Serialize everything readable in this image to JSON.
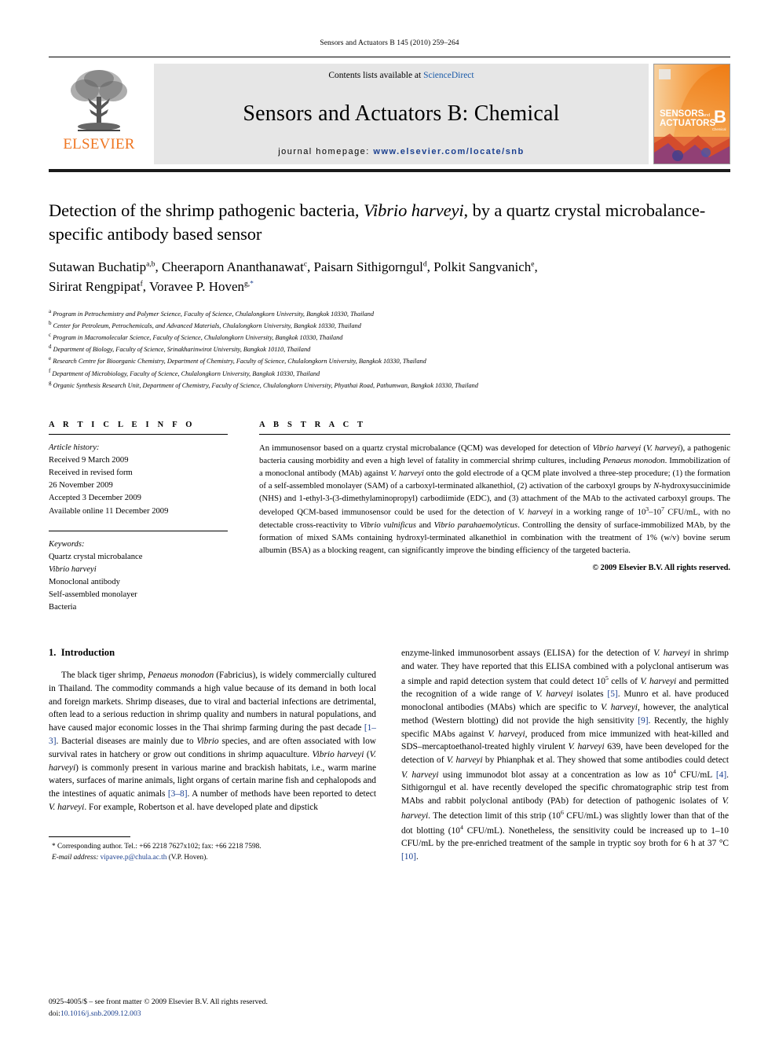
{
  "running_head": "Sensors and Actuators B 145 (2010) 259–264",
  "masthead": {
    "publisher": "ELSEVIER",
    "contents_prefix": "Contents lists available at ",
    "contents_link": "ScienceDirect",
    "journal_title": "Sensors and Actuators B: Chemical",
    "homepage_label": "journal homepage:",
    "homepage_url": "www.elsevier.com/locate/snb",
    "cover": {
      "line1": "SENSORS",
      "line1_suffix": "and",
      "line2": "ACTUATORS",
      "letter": "B",
      "sublabel": "Chemical",
      "accent_color": "#f07d19",
      "background_color": "#f3a24a"
    }
  },
  "article": {
    "title_part1": "Detection of the shrimp pathogenic bacteria, ",
    "title_italic": "Vibrio harveyi",
    "title_part2": ", by a quartz crystal microbalance-specific antibody based sensor",
    "authors": [
      {
        "name": "Sutawan Buchatip",
        "sup": "a,b",
        "sep": ", "
      },
      {
        "name": "Cheeraporn Ananthanawat",
        "sup": "c",
        "sep": ", "
      },
      {
        "name": "Paisarn Sithigorngul",
        "sup": "d",
        "sep": ", "
      },
      {
        "name": "Polkit Sangvanich",
        "sup": "e",
        "sep": ", "
      },
      {
        "name": "Sirirat Rengpipat",
        "sup": "f",
        "sep": ", "
      },
      {
        "name": "Voravee P. Hoven",
        "sup": "g,",
        "sep": ""
      }
    ],
    "corresponding_marker": "*",
    "affiliations": [
      {
        "mark": "a",
        "text": "Program in Petrochemistry and Polymer Science, Faculty of Science, Chulalongkorn University, Bangkok 10330, Thailand"
      },
      {
        "mark": "b",
        "text": "Center for Petroleum, Petrochemicals, and Advanced Materials, Chulalongkorn University, Bangkok 10330, Thailand"
      },
      {
        "mark": "c",
        "text": "Program in Macromolecular Science, Faculty of Science, Chulalongkorn University, Bangkok 10330, Thailand"
      },
      {
        "mark": "d",
        "text": "Department of Biology, Faculty of Science, Srinakharinwirot University, Bangkok 10110, Thailand"
      },
      {
        "mark": "e",
        "text": "Research Centre for Bioorganic Chemistry, Department of Chemistry, Faculty of Science, Chulalongkorn University, Bangkok 10330, Thailand"
      },
      {
        "mark": "f",
        "text": "Department of Microbiology, Faculty of Science, Chulalongkorn University, Bangkok 10330, Thailand"
      },
      {
        "mark": "g",
        "text": "Organic Synthesis Research Unit, Department of Chemistry, Faculty of Science, Chulalongkorn University, Phyathai Road, Pathumwan, Bangkok 10330, Thailand"
      }
    ]
  },
  "article_info": {
    "heading": "A R T I C L E    I N F O",
    "history_label": "Article history:",
    "history": [
      "Received 9 March 2009",
      "Received in revised form",
      "26 November 2009",
      "Accepted 3 December 2009",
      "Available online 11 December 2009"
    ],
    "keywords_label": "Keywords:",
    "keywords": [
      "Quartz crystal microbalance",
      "Vibrio harveyi",
      "Monoclonal antibody",
      "Self-assembled monolayer",
      "Bacteria"
    ],
    "keywords_italic_index": 1
  },
  "abstract": {
    "heading": "A B S T R A C T",
    "copyright": "© 2009 Elsevier B.V. All rights reserved."
  },
  "introduction": {
    "number": "1.",
    "heading": "Introduction"
  },
  "footnote": {
    "corresponding": "* Corresponding author. Tel.: +66 2218 7627x102; fax: +66 2218 7598.",
    "email_label": "E-mail address:",
    "email": "vipavee.p@chula.ac.th",
    "email_attrib": "(V.P. Hoven)."
  },
  "footer": {
    "issn_line": "0925-4005/$ – see front matter © 2009 Elsevier B.V. All rights reserved.",
    "doi_label": "doi:",
    "doi": "10.1016/j.snb.2009.12.003"
  }
}
